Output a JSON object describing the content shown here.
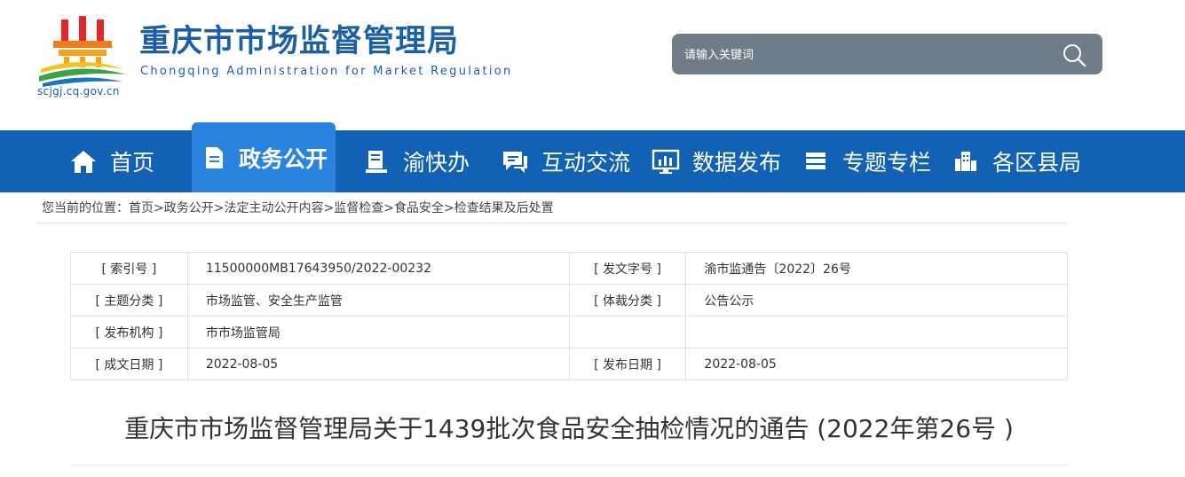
{
  "header": {
    "title": "重庆市市场监督管理局",
    "subtitle": "Chongqing Administration for Market Regulation",
    "domain": "scjgj.cq.gov.cn",
    "brand_color": "#1b5fa8"
  },
  "search": {
    "placeholder": "请输入关键词",
    "icon": "search-icon"
  },
  "nav": {
    "color": "#1161b5",
    "active_color": "#2a83dd",
    "items": [
      {
        "label": "首页",
        "icon": "home-icon"
      },
      {
        "label": "政务公开",
        "icon": "document-icon",
        "active": true
      },
      {
        "label": "渝快办",
        "icon": "book-icon"
      },
      {
        "label": "互动交流",
        "icon": "chat-icon"
      },
      {
        "label": "数据发布",
        "icon": "chart-monitor-icon"
      },
      {
        "label": "专题专栏",
        "icon": "stack-icon"
      },
      {
        "label": "各区县局",
        "icon": "buildings-icon"
      }
    ]
  },
  "breadcrumb": {
    "prefix": "您当前的位置：",
    "items": [
      "首页",
      "政务公开",
      "法定主动公开内容",
      "监督检查",
      "食品安全",
      "检查结果及后处置"
    ],
    "sep": ">"
  },
  "meta": {
    "rows": [
      [
        {
          "label": "[ 索引号 ]",
          "value": "11500000MB17643950/2022-00232"
        },
        {
          "label": "[ 发文字号 ]",
          "value": "渝市监通告〔2022〕26号"
        }
      ],
      [
        {
          "label": "[ 主题分类 ]",
          "value": "市场监管、安全生产监管"
        },
        {
          "label": "[ 体裁分类 ]",
          "value": "公告公示"
        }
      ],
      [
        {
          "label": "[ 发布机构 ]",
          "value": "市市场监管局"
        },
        {
          "label": "",
          "value": ""
        }
      ],
      [
        {
          "label": "[ 成文日期 ]",
          "value": "2022-08-05"
        },
        {
          "label": "[ 发布日期 ]",
          "value": "2022-08-05"
        }
      ]
    ]
  },
  "article": {
    "title": "重庆市市场监督管理局关于1439批次食品安全抽检情况的通告 (2022年第26号 )"
  }
}
